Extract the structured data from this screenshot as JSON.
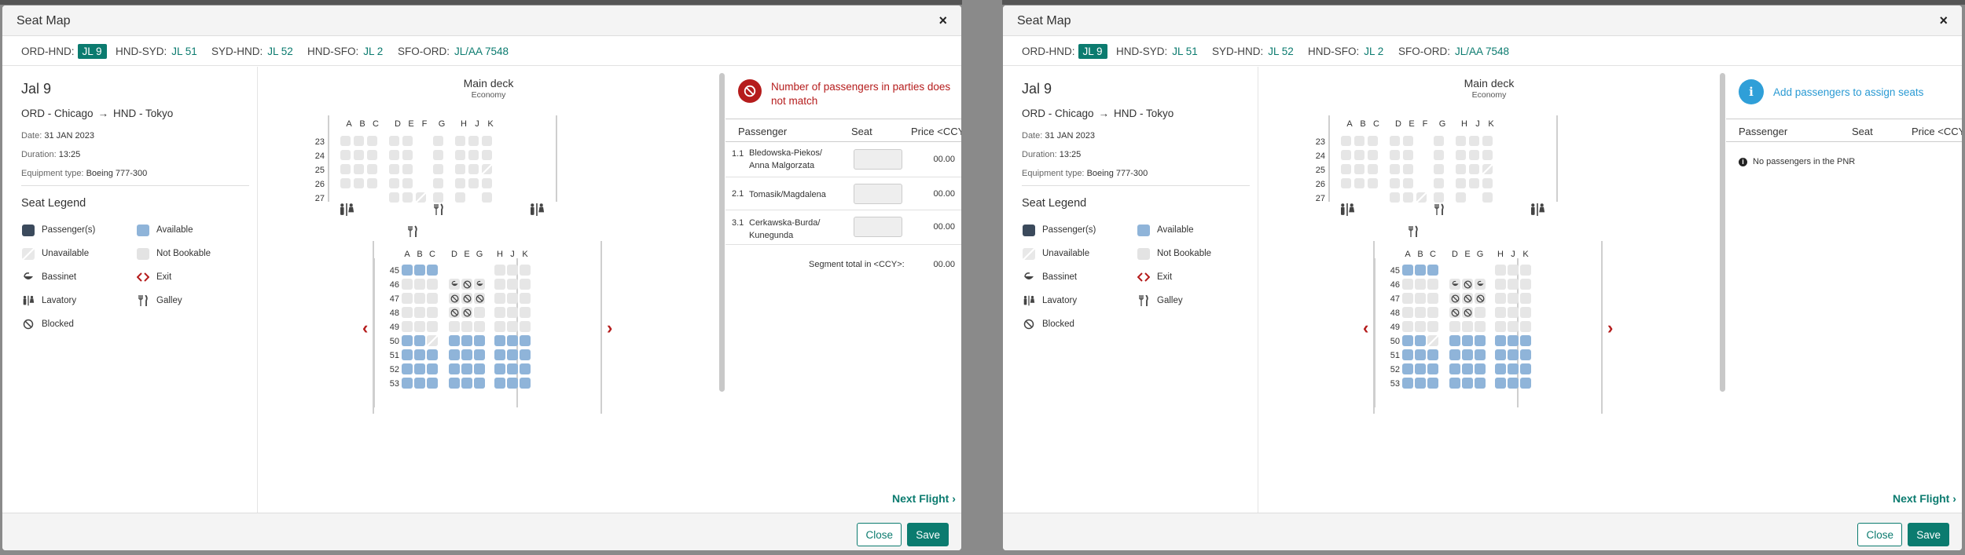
{
  "modal_title": "Seat Map",
  "close_glyph": "×",
  "segments": [
    {
      "code": "ORD-HND:",
      "flight": "JL 9",
      "active": true
    },
    {
      "code": "HND-SYD:",
      "flight": "JL 51",
      "active": false
    },
    {
      "code": "SYD-HND:",
      "flight": "JL 52",
      "active": false
    },
    {
      "code": "HND-SFO:",
      "flight": "JL 2",
      "active": false
    },
    {
      "code": "SFO-ORD:",
      "flight": "JL/AA 7548",
      "active": false
    }
  ],
  "flight": {
    "title": "Jal 9",
    "origin": "ORD - Chicago",
    "destination": "HND - Tokyo",
    "date_label": "Date:",
    "date_value": "31 JAN 2023",
    "duration_label": "Duration:",
    "duration_value": "13:25",
    "equipment_label": "Equipment type:",
    "equipment_value": "Boeing 777-300"
  },
  "legend": {
    "title": "Seat Legend",
    "items": [
      {
        "label": "Passenger(s)",
        "icon": "passenger-swatch"
      },
      {
        "label": "Available",
        "icon": "available-swatch"
      },
      {
        "label": "Unavailable",
        "icon": "unavailable-swatch"
      },
      {
        "label": "Not Bookable",
        "icon": "not-bookable-swatch"
      },
      {
        "label": "Bassinet",
        "icon": "bassinet-icon"
      },
      {
        "label": "Exit",
        "icon": "exit-icon"
      },
      {
        "label": "Lavatory",
        "icon": "lavatory-icon"
      },
      {
        "label": "Galley",
        "icon": "galley-icon"
      },
      {
        "label": "Blocked",
        "icon": "blocked-icon"
      }
    ]
  },
  "deck": {
    "title": "Main deck",
    "cabin": "Economy",
    "upper_columns": [
      "A",
      "B",
      "C",
      "D",
      "E",
      "F",
      "G",
      "H",
      "J",
      "K"
    ],
    "upper_rows": [
      {
        "num": "23",
        "seats": [
          "nb",
          "nb",
          "nb",
          "nb",
          "nb",
          "",
          "nb",
          "nb",
          "nb",
          "nb"
        ]
      },
      {
        "num": "24",
        "seats": [
          "nb",
          "nb",
          "nb",
          "nb",
          "nb",
          "",
          "nb",
          "nb",
          "nb",
          "nb"
        ]
      },
      {
        "num": "25",
        "seats": [
          "nb",
          "nb",
          "nb",
          "nb",
          "nb",
          "",
          "nb",
          "nb",
          "nb",
          "un"
        ]
      },
      {
        "num": "26",
        "seats": [
          "nb",
          "nb",
          "nb",
          "nb",
          "nb",
          "",
          "nb",
          "nb",
          "nb",
          "nb"
        ]
      },
      {
        "num": "27",
        "seats": [
          "",
          "",
          "",
          "nb",
          "nb",
          "un",
          "nb",
          "nb",
          "",
          "nb"
        ]
      }
    ],
    "lower_columns": [
      "A",
      "B",
      "C",
      "D",
      "E",
      "G",
      "H",
      "J",
      "K"
    ],
    "lower_rows": [
      {
        "num": "45",
        "seats": [
          "av",
          "av",
          "av",
          "",
          "",
          "",
          "nb",
          "nb",
          "nb"
        ]
      },
      {
        "num": "46",
        "seats": [
          "nb",
          "nb",
          "nb",
          "bs",
          "bl",
          "bs",
          "nb",
          "nb",
          "nb"
        ]
      },
      {
        "num": "47",
        "seats": [
          "nb",
          "nb",
          "nb",
          "bl",
          "bl",
          "bl",
          "nb",
          "nb",
          "nb"
        ]
      },
      {
        "num": "48",
        "seats": [
          "nb",
          "nb",
          "nb",
          "bl",
          "bl",
          "nb",
          "nb",
          "nb",
          "nb"
        ]
      },
      {
        "num": "49",
        "seats": [
          "nb",
          "nb",
          "nb",
          "nb",
          "nb",
          "nb",
          "nb",
          "nb",
          "nb"
        ]
      },
      {
        "num": "50",
        "seats": [
          "av",
          "av",
          "un",
          "av",
          "av",
          "av",
          "av",
          "av",
          "av"
        ]
      },
      {
        "num": "51",
        "seats": [
          "av",
          "av",
          "av",
          "av",
          "av",
          "av",
          "av",
          "av",
          "av"
        ]
      },
      {
        "num": "52",
        "seats": [
          "av",
          "av",
          "av",
          "av",
          "av",
          "av",
          "av",
          "av",
          "av"
        ]
      },
      {
        "num": "53",
        "seats": [
          "av",
          "av",
          "av",
          "av",
          "av",
          "av",
          "av",
          "av",
          "av"
        ]
      }
    ]
  },
  "table_headers": {
    "passenger": "Passenger",
    "seat": "Seat",
    "price": "Price <CCY>"
  },
  "left_panel": {
    "warning": "Number of passengers in parties does not match",
    "passengers": [
      {
        "num": "1.1",
        "name": "Bledowska-Piekos/ Anna Malgorzata",
        "price": "00.00"
      },
      {
        "num": "2.1",
        "name": "Tomasik/Magdalena",
        "price": "00.00"
      },
      {
        "num": "3.1",
        "name": "Cerkawska-Burda/ Kunegunda",
        "price": "00.00"
      }
    ],
    "segment_total_label": "Segment total in <CCY>:",
    "segment_total_value": "00.00"
  },
  "right_panel": {
    "info": "Add passengers to assign seats",
    "no_passengers": "No passengers in the PNR"
  },
  "next_flight": "Next Flight",
  "buttons": {
    "close": "Close",
    "save": "Save"
  },
  "colors": {
    "brand": "#0b7b6f",
    "available": "#8fb4d9",
    "passenger": "#3b4a5c",
    "error": "#b51c1c",
    "info": "#2f9fd8"
  }
}
